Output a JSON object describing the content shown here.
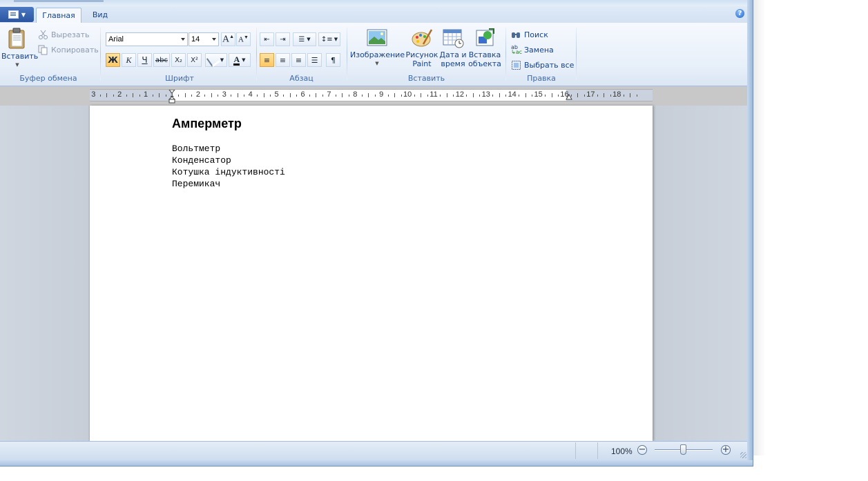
{
  "tabs": {
    "app_menu": "",
    "home": "Главная",
    "view": "Вид"
  },
  "clipboard": {
    "paste": "Вставить",
    "cut": "Вырезать",
    "copy": "Копировать",
    "group": "Буфер обмена"
  },
  "font": {
    "family": "Arial",
    "size": "14",
    "bold": "Ж",
    "italic": "К",
    "underline": "Ч",
    "strike": "abc",
    "subscript": "X₂",
    "superscript": "X²",
    "color_letter": "A",
    "group": "Шрифт"
  },
  "paragraph": {
    "group": "Абзац"
  },
  "insert": {
    "picture": "Изображение",
    "paint_1": "Рисунок",
    "paint_2": "Paint",
    "datetime_1": "Дата и",
    "datetime_2": "время",
    "object_1": "Вставка",
    "object_2": "объекта",
    "group": "Вставить"
  },
  "editing": {
    "find": "Поиск",
    "replace": "Замена",
    "select_all": "Выбрать все",
    "group": "Правка"
  },
  "ruler": {
    "labels": [
      "3",
      "2",
      "1",
      "1",
      "2",
      "3",
      "4",
      "5",
      "6",
      "7",
      "8",
      "9",
      "10",
      "11",
      "12",
      "13",
      "14",
      "15",
      "16",
      "17",
      "18"
    ]
  },
  "document": {
    "heading": "Амперметр",
    "lines": [
      "Вольтметр",
      "Конденсатор",
      "Котушка індуктивності",
      "Перемикач"
    ]
  },
  "status": {
    "zoom": "100%",
    "zoom_out": "−",
    "zoom_in": "+"
  },
  "colors": {
    "accent": "#15428b",
    "ribbon_bg": "#e7eff9",
    "active_button": "#ffc864"
  },
  "icons": [
    "paste-icon",
    "cut-icon",
    "copy-icon",
    "bold-icon",
    "picture-icon",
    "paint-icon",
    "datetime-icon",
    "object-icon",
    "find-icon",
    "replace-icon",
    "select-all-icon",
    "help-icon"
  ]
}
